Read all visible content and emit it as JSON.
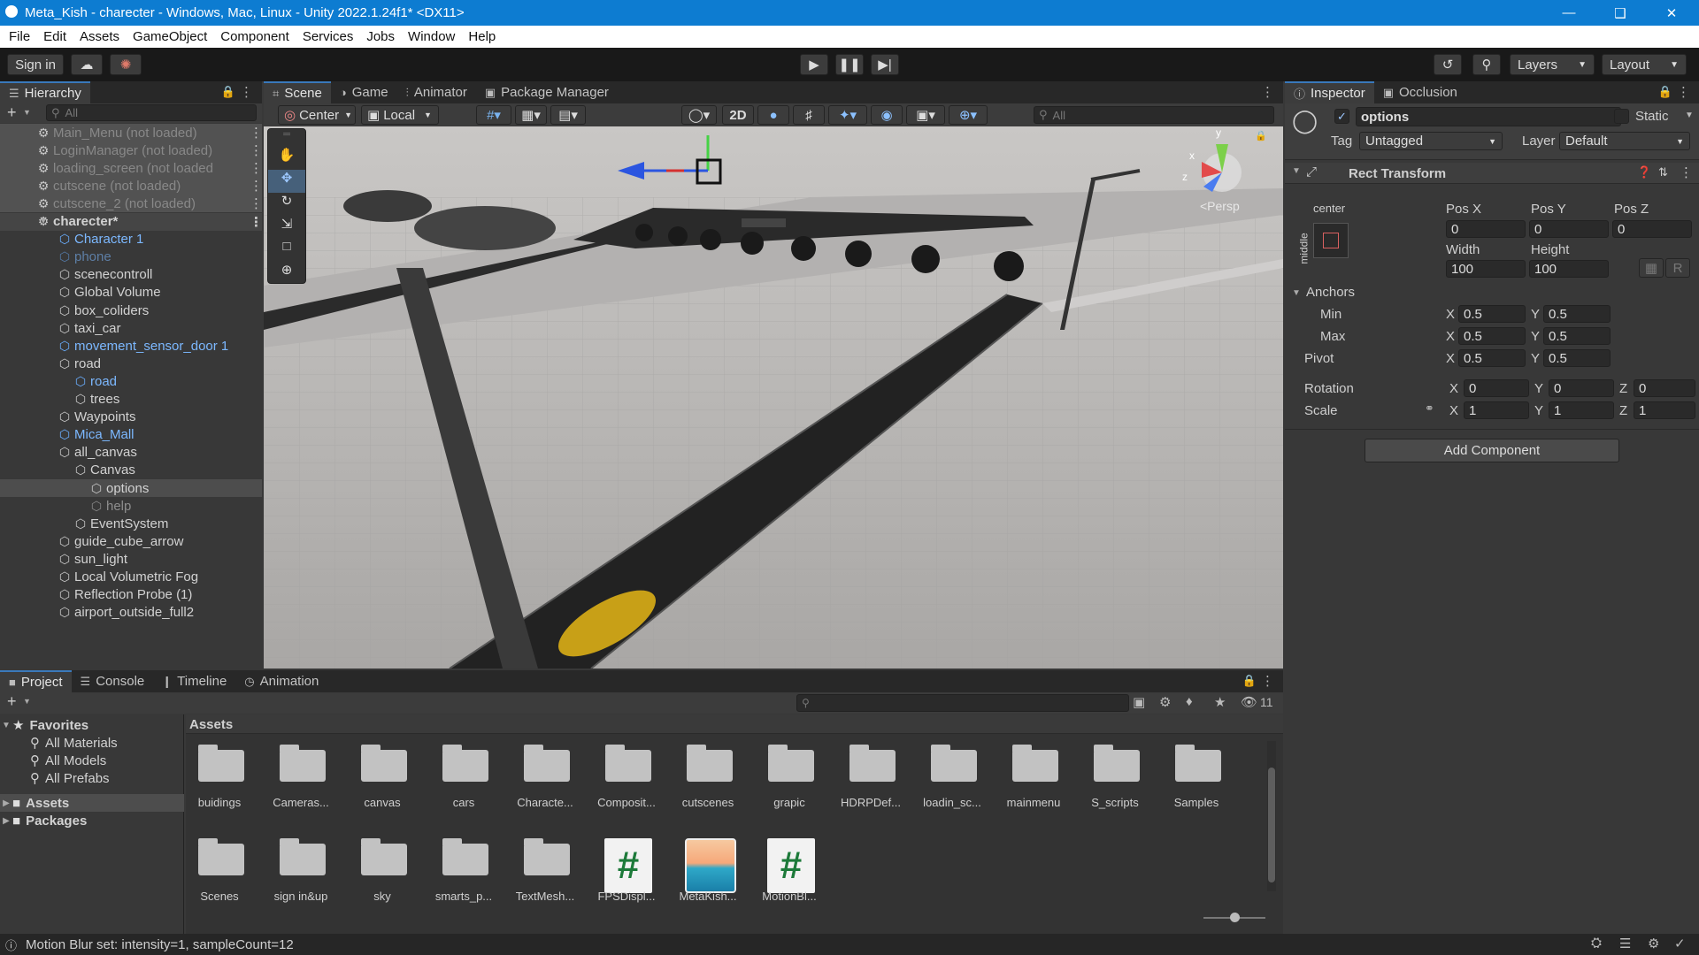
{
  "window": {
    "title": "Meta_Kish - charecter - Windows, Mac, Linux - Unity 2022.1.24f1* <DX11>"
  },
  "menu": [
    "File",
    "Edit",
    "Assets",
    "GameObject",
    "Component",
    "Services",
    "Jobs",
    "Window",
    "Help"
  ],
  "toolbar": {
    "sign_in": "Sign in",
    "layers": "Layers",
    "layout": "Layout"
  },
  "hierarchy": {
    "tab": "Hierarchy",
    "search_placeholder": "All",
    "items": [
      {
        "label": "Main_Menu (not loaded)",
        "type": "scene-unloaded",
        "depth": 0
      },
      {
        "label": "LoginManager (not loaded)",
        "type": "scene-unloaded",
        "depth": 0
      },
      {
        "label": "loading_screen (not loaded",
        "type": "scene-unloaded",
        "depth": 0
      },
      {
        "label": "cutscene (not loaded)",
        "type": "scene-unloaded",
        "depth": 0
      },
      {
        "label": "cutscene_2 (not loaded)",
        "type": "scene-unloaded",
        "depth": 0
      },
      {
        "label": "charecter*",
        "type": "scene",
        "depth": 0
      },
      {
        "label": "Character 1",
        "type": "prefab",
        "depth": 1
      },
      {
        "label": "phone",
        "type": "prefab-dim",
        "depth": 1
      },
      {
        "label": "scenecontroll",
        "type": "obj",
        "depth": 1
      },
      {
        "label": "Global Volume",
        "type": "obj",
        "depth": 1
      },
      {
        "label": "box_coliders",
        "type": "obj",
        "depth": 1
      },
      {
        "label": "taxi_car",
        "type": "obj",
        "depth": 1
      },
      {
        "label": "movement_sensor_door 1",
        "type": "prefab",
        "depth": 1
      },
      {
        "label": "road",
        "type": "obj",
        "depth": 1
      },
      {
        "label": "road",
        "type": "prefab",
        "depth": 2
      },
      {
        "label": "trees",
        "type": "obj",
        "depth": 2
      },
      {
        "label": "Waypoints",
        "type": "obj",
        "depth": 1
      },
      {
        "label": "Mica_Mall",
        "type": "prefab",
        "depth": 1
      },
      {
        "label": "all_canvas",
        "type": "obj",
        "depth": 1
      },
      {
        "label": "Canvas",
        "type": "obj",
        "depth": 2
      },
      {
        "label": "options",
        "type": "obj-selected",
        "depth": 3
      },
      {
        "label": "help",
        "type": "obj-dim",
        "depth": 3
      },
      {
        "label": "EventSystem",
        "type": "obj",
        "depth": 2
      },
      {
        "label": "guide_cube_arrow",
        "type": "obj",
        "depth": 1
      },
      {
        "label": "sun_light",
        "type": "obj",
        "depth": 1
      },
      {
        "label": "Local Volumetric Fog",
        "type": "obj",
        "depth": 1
      },
      {
        "label": "Reflection Probe (1)",
        "type": "obj",
        "depth": 1
      },
      {
        "label": "airport_outside_full2",
        "type": "obj",
        "depth": 1
      }
    ]
  },
  "scene_tabs": [
    "Scene",
    "Game",
    "Animator",
    "Package Manager"
  ],
  "scene_toolbar": {
    "pivot": "Center",
    "space": "Local",
    "mode2d": "2D",
    "search_placeholder": "All"
  },
  "scene_view": {
    "persp_label": "<Persp",
    "gizmo_y": "y",
    "gizmo_x": "x",
    "gizmo_z": "z"
  },
  "inspector": {
    "tabs": [
      "Inspector",
      "Occlusion"
    ],
    "object_name": "options",
    "static_label": "Static",
    "tag_label": "Tag",
    "tag_value": "Untagged",
    "layer_label": "Layer",
    "layer_value": "Default",
    "component_title": "Rect Transform",
    "anchor_h": "center",
    "anchor_v": "middle",
    "pos_x_label": "Pos X",
    "pos_y_label": "Pos Y",
    "pos_z_label": "Pos Z",
    "pos_x": "0",
    "pos_y": "0",
    "pos_z": "0",
    "width_label": "Width",
    "height_label": "Height",
    "width": "100",
    "height": "100",
    "r_label": "R",
    "anchors_label": "Anchors",
    "min_label": "Min",
    "max_label": "Max",
    "pivot_label": "Pivot",
    "x": "X",
    "y": "Y",
    "z": "Z",
    "min_x": "0.5",
    "min_y": "0.5",
    "max_x": "0.5",
    "max_y": "0.5",
    "pivot_x": "0.5",
    "pivot_y": "0.5",
    "rotation_label": "Rotation",
    "rot_x": "0",
    "rot_y": "0",
    "rot_z": "0",
    "scale_label": "Scale",
    "scale_x": "1",
    "scale_y": "1",
    "scale_z": "1",
    "add_component": "Add Component"
  },
  "bottom_tabs": [
    "Project",
    "Console",
    "Timeline",
    "Animation"
  ],
  "project": {
    "favorites_label": "Favorites",
    "favorites": [
      "All Materials",
      "All Models",
      "All Prefabs"
    ],
    "roots": [
      "Assets",
      "Packages"
    ],
    "breadcrumb": "Assets",
    "hidden_count": "11",
    "assets": [
      {
        "name": "buidings",
        "kind": "folder"
      },
      {
        "name": "Cameras...",
        "kind": "folder"
      },
      {
        "name": "canvas",
        "kind": "folder"
      },
      {
        "name": "cars",
        "kind": "folder"
      },
      {
        "name": "Characte...",
        "kind": "folder"
      },
      {
        "name": "Composit...",
        "kind": "folder"
      },
      {
        "name": "cutscenes",
        "kind": "folder"
      },
      {
        "name": "grapic",
        "kind": "folder"
      },
      {
        "name": "HDRPDef...",
        "kind": "folder"
      },
      {
        "name": "loadin_sc...",
        "kind": "folder"
      },
      {
        "name": "mainmenu",
        "kind": "folder"
      },
      {
        "name": "S_scripts",
        "kind": "folder"
      },
      {
        "name": "Samples",
        "kind": "folder"
      },
      {
        "name": "Scenes",
        "kind": "folder"
      },
      {
        "name": "sign in&up",
        "kind": "folder"
      },
      {
        "name": "sky",
        "kind": "folder"
      },
      {
        "name": "smarts_p...",
        "kind": "folder"
      },
      {
        "name": "TextMesh...",
        "kind": "folder"
      },
      {
        "name": "FPSDispl...",
        "kind": "script"
      },
      {
        "name": "MetaKish...",
        "kind": "image"
      },
      {
        "name": "MotionBl...",
        "kind": "script"
      }
    ]
  },
  "status": {
    "message": "Motion Blur set: intensity=1, sampleCount=12"
  }
}
